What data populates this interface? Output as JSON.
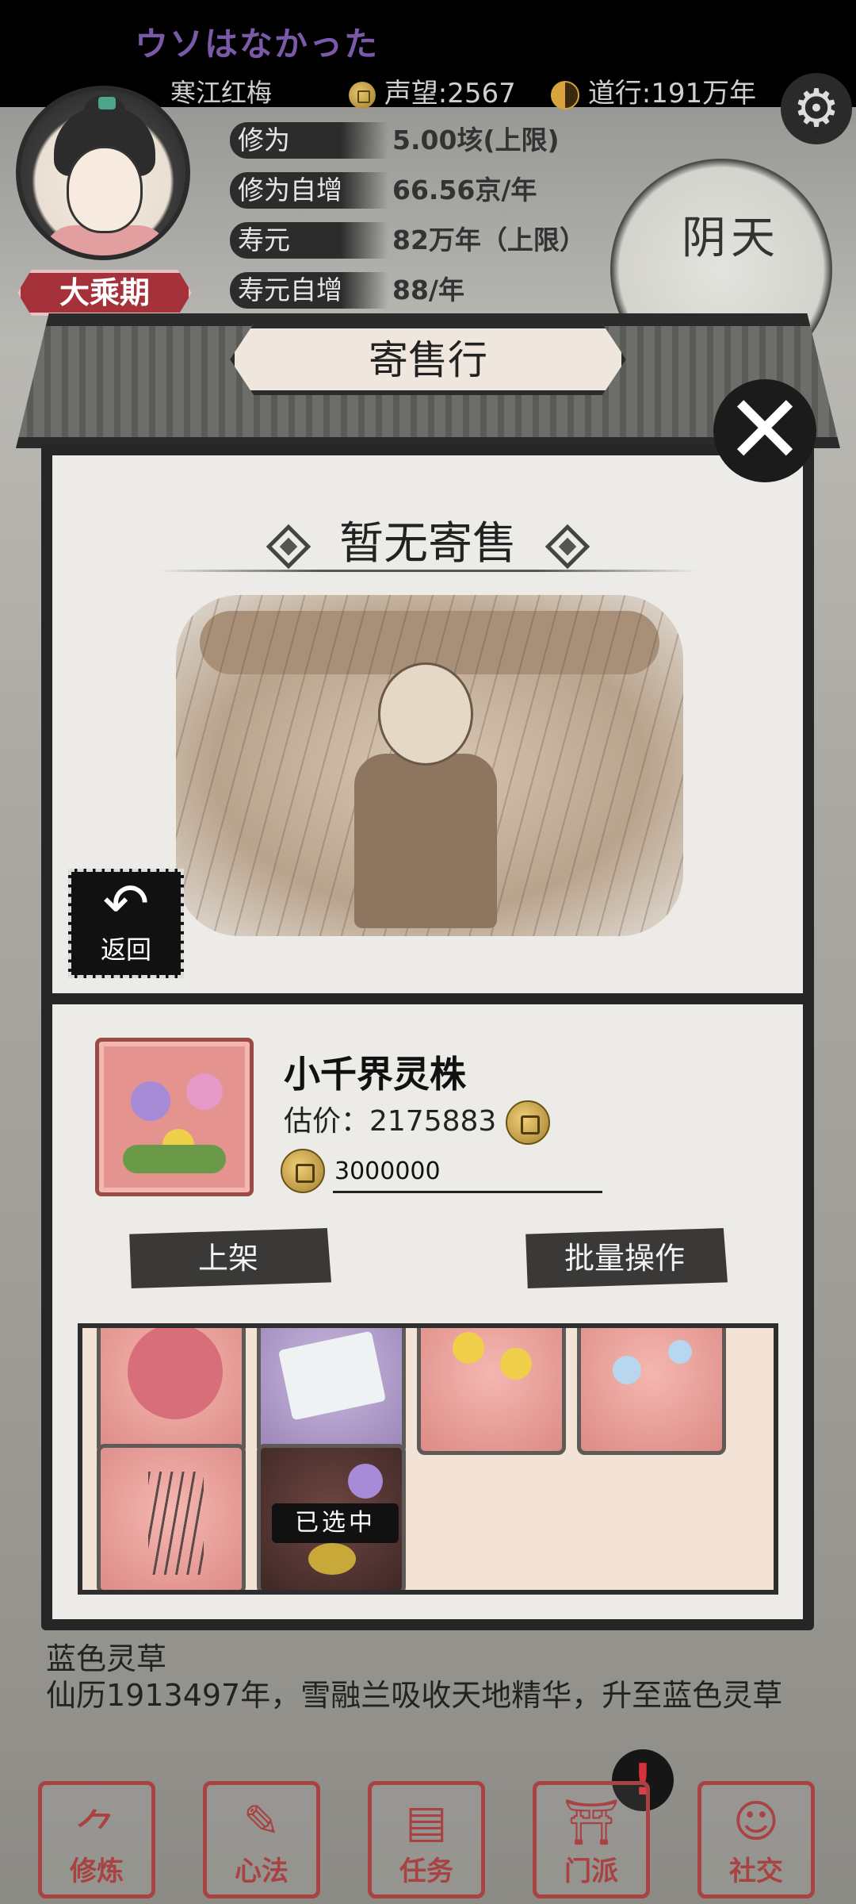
{
  "topbar": {
    "marquee": "ウソはなかった",
    "player_name": "寒江红梅",
    "reputation_label": "声望:2567",
    "dao_label": "道行:191万年"
  },
  "player": {
    "realm": "大乘期",
    "attributes": [
      {
        "label": "修为",
        "value": "5.00垓(上限)"
      },
      {
        "label": "修为自增",
        "value": "66.56京/年"
      },
      {
        "label": "寿元",
        "value": "82万年（上限）"
      },
      {
        "label": "寿元自增",
        "value": "88/年"
      }
    ],
    "weather": "阴天"
  },
  "shop": {
    "title": "寄售行",
    "empty_title": "暂无寄售",
    "back_label": "返回"
  },
  "selected_item": {
    "name": "小千界灵株",
    "price_text": "估价：2175883",
    "listing_price": "3000000"
  },
  "actions": {
    "list_label": "上架",
    "batch_label": "批量操作"
  },
  "inventory": {
    "selected_tag": "已选中"
  },
  "log": {
    "line1": "蓝色灵草",
    "line2": "仙历1913497年，雪融兰吸收天地精华，升至蓝色灵草"
  },
  "nav": [
    {
      "label": "修炼",
      "icon": "cultivate-icon"
    },
    {
      "label": "心法",
      "icon": "scroll-icon"
    },
    {
      "label": "任务",
      "icon": "quest-icon"
    },
    {
      "label": "门派",
      "icon": "sect-icon"
    },
    {
      "label": "社交",
      "icon": "social-icon"
    }
  ],
  "colors": {
    "realm_badge": "#a5323a",
    "nav_accent": "#a94242",
    "item_slot": "#e5938e",
    "alert": "#d5313a"
  }
}
